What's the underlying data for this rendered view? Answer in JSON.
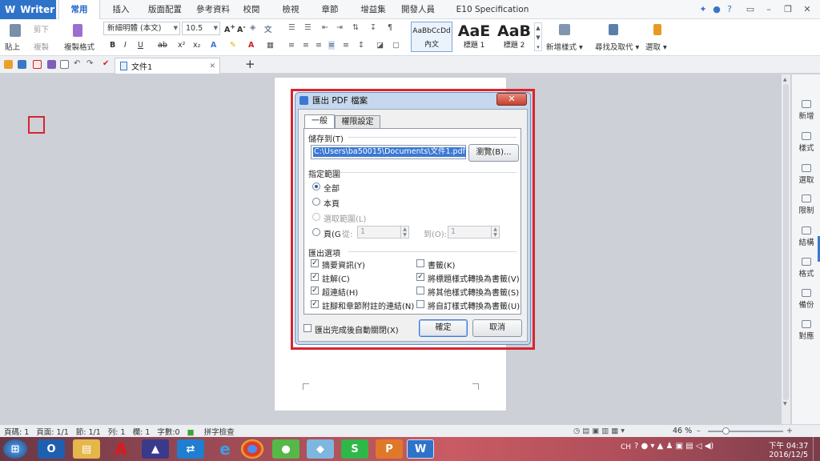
{
  "app": {
    "name": "Writer"
  },
  "ribbon_tabs": [
    "常用",
    "插入",
    "版面配置",
    "參考資料",
    "校閱",
    "檢視",
    "章節",
    "增益集",
    "開發人員",
    "E10 Specification Plugin"
  ],
  "ribbon": {
    "paste": "貼上",
    "cut": "剪下",
    "copy": "複製",
    "format_painter": "複製格式",
    "font_name": "新細明體 (本文)",
    "font_size": "10.5",
    "styles": [
      {
        "preview": "AaBbCcDd",
        "name": "內文"
      },
      {
        "preview": "AaE",
        "name": "標題 1"
      },
      {
        "preview": "AaB",
        "name": "標題 2"
      }
    ],
    "new_style": "新增樣式",
    "find_replace": "尋找及取代",
    "select": "選取"
  },
  "document_tab": {
    "title": "文件1"
  },
  "right_panel": [
    "新增",
    "樣式",
    "選取",
    "限制",
    "結構",
    "格式",
    "備份",
    "對應"
  ],
  "dialog": {
    "title": "匯出 PDF 檔案",
    "tabs": [
      "一般",
      "權限設定"
    ],
    "save_to_label": "儲存到(T)",
    "path": "C:\\Users\\ba50015\\Documents\\文件1.pdf",
    "browse": "瀏覽(B)...",
    "range_label": "指定範圍",
    "range_all": "全部",
    "range_current": "本頁",
    "range_selection": "選取範圍(L)",
    "range_pages": "頁(G",
    "range_from": "從:",
    "range_from_value": "1",
    "range_to": "到(O):",
    "range_to_value": "1",
    "export_label": "匯出選項",
    "options_left": [
      {
        "label": "摘要資訊(Y)",
        "checked": true
      },
      {
        "label": "註解(C)",
        "checked": true
      },
      {
        "label": "超連結(H)",
        "checked": true
      },
      {
        "label": "註腳和章節附註的連結(N)",
        "checked": true
      }
    ],
    "options_right": [
      {
        "label": "書籤(K)",
        "checked": false
      },
      {
        "label": "將標題樣式轉換為書籤(V)",
        "checked": true
      },
      {
        "label": "將其他樣式轉換為書籤(S)",
        "checked": false
      },
      {
        "label": "將自訂樣式轉換為書籤(U)",
        "checked": false
      }
    ],
    "auto_close": "匯出完成後自動關閉(X)",
    "ok": "確定",
    "cancel": "取消"
  },
  "status_bar": {
    "page": "頁碼: 1",
    "pages": "頁面: 1/1",
    "section": "節: 1/1",
    "row": "列: 1",
    "col": "欄: 1",
    "words": "字數:0",
    "spell": "拼字檢查",
    "zoom": "46 %"
  },
  "taskbar": {
    "ime": "CH",
    "time": "下午 04:37",
    "date": "2016/12/5"
  },
  "colors": {
    "accent": "#2f73c9",
    "highlight_frame": "#d8242f"
  }
}
